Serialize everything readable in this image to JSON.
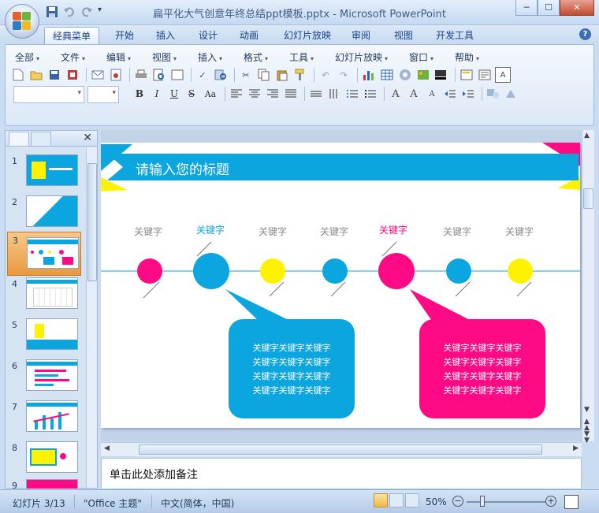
{
  "window": {
    "title": "扁平化大气创意年终总结ppt模板.pptx - Microsoft PowerPoint",
    "controls": [
      "─",
      "☐",
      "✕"
    ]
  },
  "ribbon_tabs": [
    {
      "label": "经典菜单",
      "active": true
    },
    {
      "label": "开始"
    },
    {
      "label": "插入"
    },
    {
      "label": "设计"
    },
    {
      "label": "动画"
    },
    {
      "label": "幻灯片放映"
    },
    {
      "label": "审阅"
    },
    {
      "label": "视图"
    },
    {
      "label": "开发工具"
    }
  ],
  "menu_bar": [
    {
      "label": "全部"
    },
    {
      "label": "文件"
    },
    {
      "label": "编辑"
    },
    {
      "label": "视图"
    },
    {
      "label": "插入"
    },
    {
      "label": "格式"
    },
    {
      "label": "工具"
    },
    {
      "label": "幻灯片放映"
    },
    {
      "label": "窗口"
    },
    {
      "label": "帮助"
    }
  ],
  "format_buttons": [
    "B",
    "I",
    "U",
    "S",
    "Aa"
  ],
  "slides_panel": {
    "thumbs": [
      {
        "num": "1"
      },
      {
        "num": "2"
      },
      {
        "num": "3",
        "selected": true
      },
      {
        "num": "4"
      },
      {
        "num": "5"
      },
      {
        "num": "6"
      },
      {
        "num": "7"
      },
      {
        "num": "8"
      },
      {
        "num": "9"
      }
    ]
  },
  "slide": {
    "title": "请输入您的标题",
    "keywords": [
      "关键字",
      "关键字",
      "关键字",
      "关键字",
      "关键字",
      "关键字",
      "关键字"
    ],
    "bubble_text": [
      "关键字关键字关键字",
      "关键字关键字关键字",
      "关键字关键字关键字",
      "关键字关键字关键字"
    ],
    "colors": {
      "blue": "#0ba6e0",
      "pink": "#ff0a85",
      "yellow": "#fff200",
      "gray_text": "#8a8a8a"
    }
  },
  "notes": {
    "placeholder": "单击此处添加备注"
  },
  "status": {
    "slide_info": "幻灯片 3/13",
    "theme": "\"Office 主题\"",
    "language": "中文(简体，中国)",
    "zoom": "50%"
  }
}
